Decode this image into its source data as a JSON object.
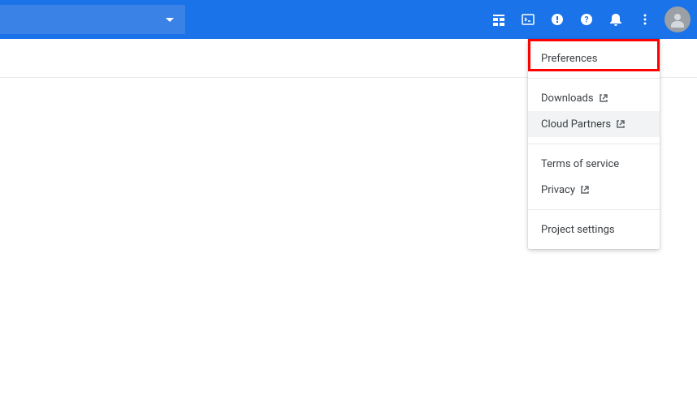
{
  "header": {
    "project_selector": ""
  },
  "menu": {
    "preferences": "Preferences",
    "downloads": "Downloads",
    "cloud_partners": "Cloud Partners",
    "terms": "Terms of service",
    "privacy": "Privacy",
    "project_settings": "Project settings"
  }
}
